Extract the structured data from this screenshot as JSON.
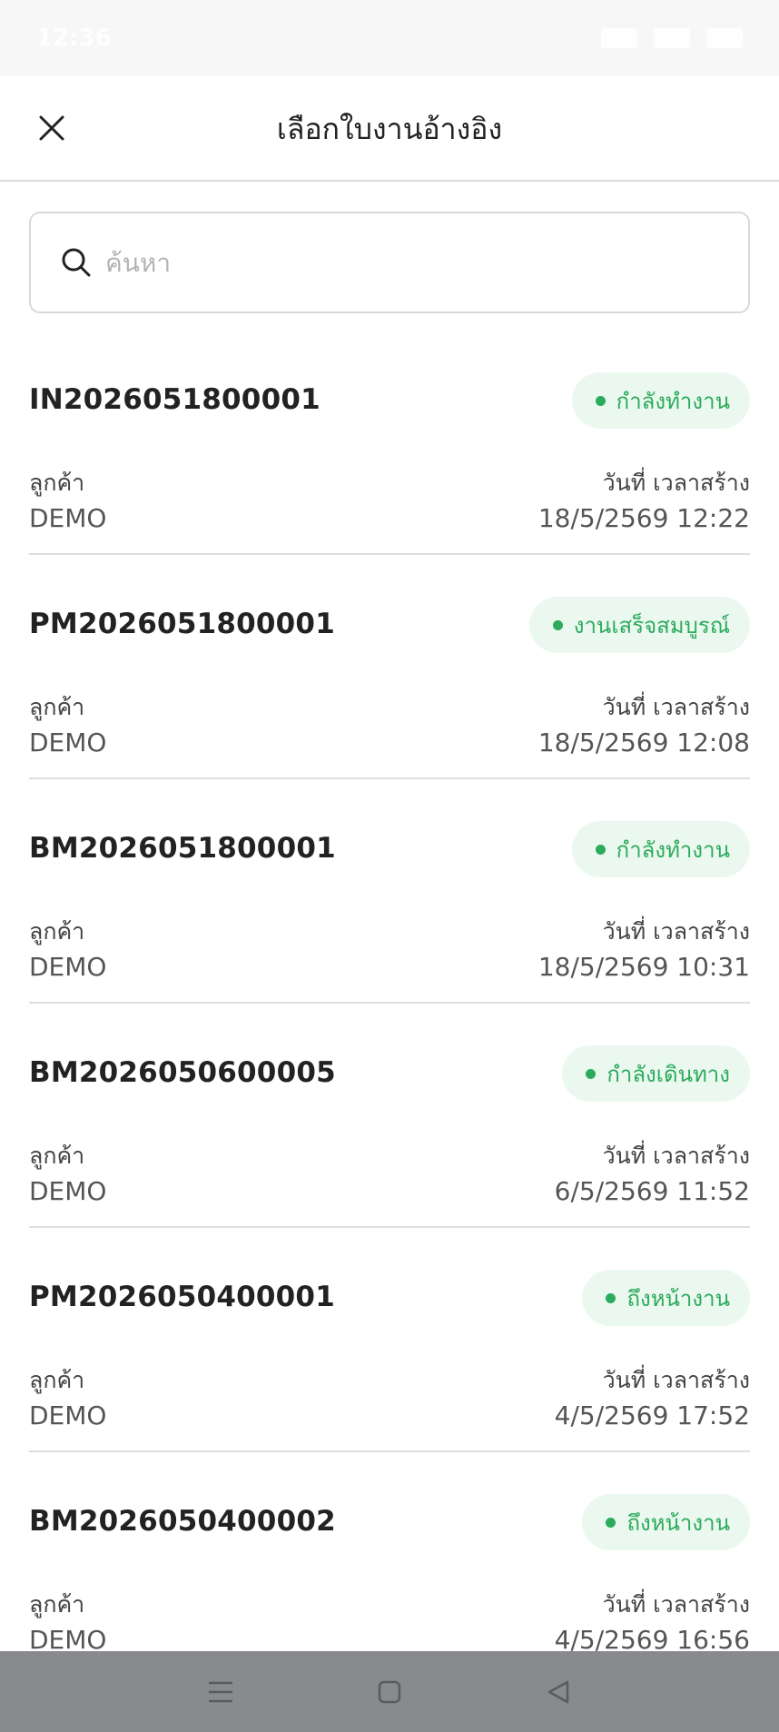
{
  "status_bar": {
    "time": "12:36"
  },
  "header": {
    "title": "เลือกใบงานอ้างอิง"
  },
  "search": {
    "placeholder": "ค้นหา",
    "value": ""
  },
  "jobs": [
    {
      "id": "IN2026051800001",
      "status": "กำลังทำงาน",
      "customer_label": "ลูกค้า",
      "customer": "DEMO",
      "date_label": "วันที่ เวลาสร้าง",
      "created": "18/5/2569 12:22"
    },
    {
      "id": "PM2026051800001",
      "status": "งานเสร็จสมบูรณ์",
      "customer_label": "ลูกค้า",
      "customer": "DEMO",
      "date_label": "วันที่ เวลาสร้าง",
      "created": "18/5/2569 12:08"
    },
    {
      "id": "BM2026051800001",
      "status": "กำลังทำงาน",
      "customer_label": "ลูกค้า",
      "customer": "DEMO",
      "date_label": "วันที่ เวลาสร้าง",
      "created": "18/5/2569 10:31"
    },
    {
      "id": "BM2026050600005",
      "status": "กำลังเดินทาง",
      "customer_label": "ลูกค้า",
      "customer": "DEMO",
      "date_label": "วันที่ เวลาสร้าง",
      "created": "6/5/2569 11:52"
    },
    {
      "id": "PM2026050400001",
      "status": "ถึงหน้างาน",
      "customer_label": "ลูกค้า",
      "customer": "DEMO",
      "date_label": "วันที่ เวลาสร้าง",
      "created": "4/5/2569 17:52"
    },
    {
      "id": "BM2026050400002",
      "status": "ถึงหน้างาน",
      "customer_label": "ลูกค้า",
      "customer": "DEMO",
      "date_label": "วันที่ เวลาสร้าง",
      "created": "4/5/2569 16:56"
    }
  ],
  "colors": {
    "status_text": "#2bab5c",
    "status_bg": "#ebf8ef",
    "divider": "#dedede",
    "nav_bar": "#898a8e"
  },
  "icons": {
    "close": "close-icon",
    "search": "search-icon",
    "nav_menu": "menu-icon",
    "nav_home": "home-icon",
    "nav_back": "back-icon"
  }
}
